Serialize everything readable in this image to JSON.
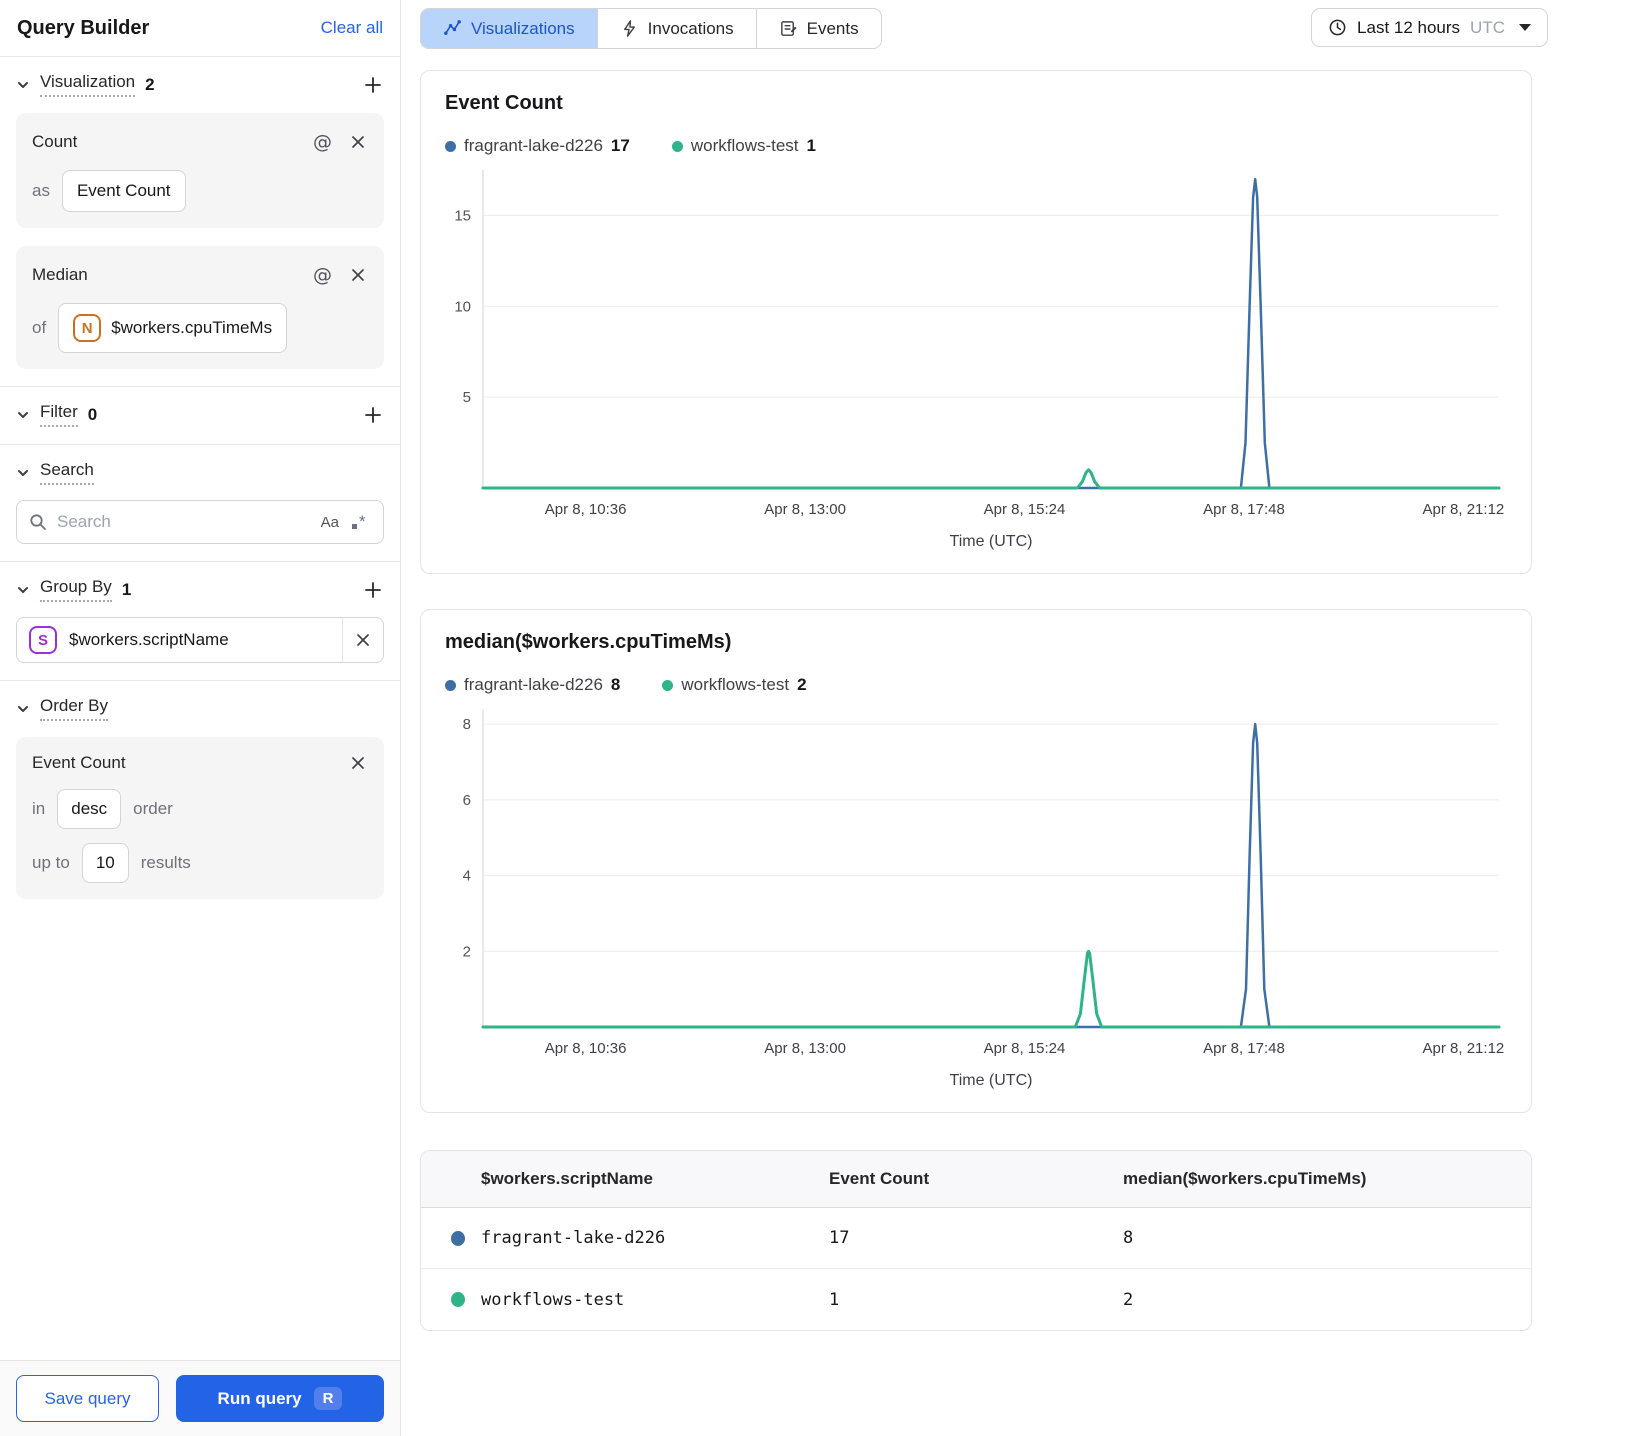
{
  "colors": {
    "accent_blue": "#2563eb",
    "series_blue": "#3d6fa5",
    "series_green": "#2eb488",
    "active_tab_bg": "#b9d4fa"
  },
  "sidebar": {
    "title": "Query Builder",
    "clear_all": "Clear all",
    "visualization": {
      "label": "Visualization",
      "count": "2"
    },
    "count_card": {
      "title": "Count",
      "as_label": "as",
      "value": "Event Count"
    },
    "median_card": {
      "title": "Median",
      "of_label": "of",
      "badge": "N",
      "value": "$workers.cpuTimeMs"
    },
    "filter": {
      "label": "Filter",
      "count": "0"
    },
    "search": {
      "label": "Search",
      "placeholder": "Search",
      "case_icon": "Aa"
    },
    "group_by": {
      "label": "Group By",
      "count": "1",
      "badge": "S",
      "value": "$workers.scriptName"
    },
    "order_by": {
      "label": "Order By",
      "field": "Event Count",
      "in_label": "in",
      "direction": "desc",
      "order_label": "order",
      "upto_label": "up to",
      "limit": "10",
      "results_label": "results"
    },
    "save_button": "Save query",
    "run_button": "Run query",
    "run_shortcut": "R"
  },
  "topbar": {
    "tabs": [
      {
        "label": "Visualizations",
        "active": true
      },
      {
        "label": "Invocations",
        "active": false
      },
      {
        "label": "Events",
        "active": false
      }
    ],
    "time_range": {
      "label": "Last 12 hours",
      "timezone": "UTC"
    }
  },
  "chart_data": [
    {
      "type": "line",
      "title": "Event Count",
      "xlabel": "Time (UTC)",
      "x_ticks": [
        {
          "label": "Apr 8, 10:36",
          "pos": 0.101
        },
        {
          "label": "Apr 8, 13:00",
          "pos": 0.317
        },
        {
          "label": "Apr 8, 15:24",
          "pos": 0.533
        },
        {
          "label": "Apr 8, 17:48",
          "pos": 0.749
        },
        {
          "label": "Apr 8, 21:12",
          "pos": 0.965
        }
      ],
      "y_ticks": [
        5,
        10,
        15
      ],
      "ylim": [
        0,
        17.5
      ],
      "grid": true,
      "legend_position": "top",
      "series": [
        {
          "name": "fragrant-lake-d226",
          "total": "17",
          "color": "#3d6fa5",
          "stroke_width": 2.5,
          "points": [
            [
              0,
              0
            ],
            [
              0.746,
              0
            ],
            [
              0.7505,
              2.5
            ],
            [
              0.7545,
              10
            ],
            [
              0.758,
              16
            ],
            [
              0.76,
              17
            ],
            [
              0.762,
              16
            ],
            [
              0.7655,
              10
            ],
            [
              0.7695,
              2.5
            ],
            [
              0.774,
              0
            ],
            [
              1,
              0
            ]
          ]
        },
        {
          "name": "workflows-test",
          "total": "1",
          "color": "#2eb488",
          "stroke_width": 3,
          "points": [
            [
              0,
              0
            ],
            [
              0.585,
              0
            ],
            [
              0.59,
              0.35
            ],
            [
              0.5935,
              0.85
            ],
            [
              0.596,
              1
            ],
            [
              0.5985,
              0.85
            ],
            [
              0.602,
              0.35
            ],
            [
              0.607,
              0
            ],
            [
              1,
              0
            ]
          ]
        }
      ]
    },
    {
      "type": "line",
      "title": "median($workers.cpuTimeMs)",
      "xlabel": "Time (UTC)",
      "x_ticks": [
        {
          "label": "Apr 8, 10:36",
          "pos": 0.101
        },
        {
          "label": "Apr 8, 13:00",
          "pos": 0.317
        },
        {
          "label": "Apr 8, 15:24",
          "pos": 0.533
        },
        {
          "label": "Apr 8, 17:48",
          "pos": 0.749
        },
        {
          "label": "Apr 8, 21:12",
          "pos": 0.965
        }
      ],
      "y_ticks": [
        2,
        4,
        6,
        8
      ],
      "ylim": [
        0,
        8.4
      ],
      "grid": true,
      "legend_position": "top",
      "series": [
        {
          "name": "fragrant-lake-d226",
          "total": "8",
          "color": "#3d6fa5",
          "stroke_width": 2.5,
          "points": [
            [
              0,
              0
            ],
            [
              0.746,
              0
            ],
            [
              0.751,
              1
            ],
            [
              0.7545,
              4.5
            ],
            [
              0.758,
              7.5
            ],
            [
              0.76,
              8
            ],
            [
              0.762,
              7.5
            ],
            [
              0.7655,
              4.5
            ],
            [
              0.769,
              1
            ],
            [
              0.774,
              0
            ],
            [
              1,
              0
            ]
          ]
        },
        {
          "name": "workflows-test",
          "total": "2",
          "color": "#2eb488",
          "stroke_width": 3,
          "points": [
            [
              0,
              0
            ],
            [
              0.583,
              0
            ],
            [
              0.588,
              0.35
            ],
            [
              0.592,
              1.3
            ],
            [
              0.595,
              1.95
            ],
            [
              0.596,
              2
            ],
            [
              0.597,
              1.95
            ],
            [
              0.6,
              1.3
            ],
            [
              0.604,
              0.35
            ],
            [
              0.609,
              0
            ],
            [
              1,
              0
            ]
          ]
        }
      ]
    }
  ],
  "table": {
    "columns": [
      "$workers.scriptName",
      "Event Count",
      "median($workers.cpuTimeMs)"
    ],
    "rows": [
      {
        "color": "#3d6fa5",
        "name": "fragrant-lake-d226",
        "event_count": "17",
        "median": "8"
      },
      {
        "color": "#2eb488",
        "name": "workflows-test",
        "event_count": "1",
        "median": "2"
      }
    ]
  }
}
